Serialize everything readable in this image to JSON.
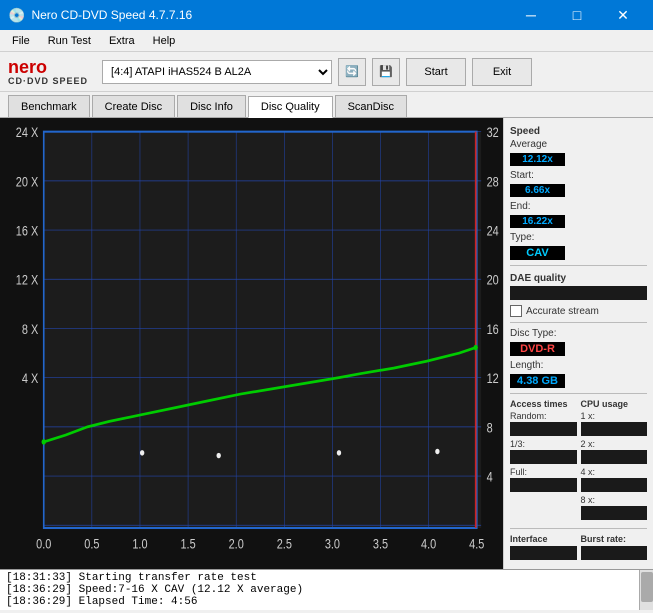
{
  "titleBar": {
    "title": "Nero CD-DVD Speed 4.7.7.16",
    "minimize": "─",
    "maximize": "□",
    "close": "✕"
  },
  "menuBar": {
    "items": [
      "File",
      "Run Test",
      "Extra",
      "Help"
    ]
  },
  "toolbar": {
    "logoNero": "nero",
    "logoDvd": "CD·DVD SPEED",
    "driveLabel": "[4:4]  ATAPI iHAS524  B AL2A",
    "startBtn": "Start",
    "exitBtn": "Exit"
  },
  "tabs": [
    {
      "label": "Benchmark",
      "active": false
    },
    {
      "label": "Create Disc",
      "active": false
    },
    {
      "label": "Disc Info",
      "active": false
    },
    {
      "label": "Disc Quality",
      "active": true
    },
    {
      "label": "ScanDisc",
      "active": false
    }
  ],
  "speedPanel": {
    "title": "Speed",
    "avgLabel": "Average",
    "avgValue": "12.12x",
    "startLabel": "Start:",
    "startValue": "6.66x",
    "endLabel": "End:",
    "endValue": "16.22x",
    "typeLabel": "Type:",
    "typeValue": "CAV"
  },
  "accessTimes": {
    "title": "Access times",
    "randomLabel": "Random:",
    "oneThirdLabel": "1/3:",
    "fullLabel": "Full:"
  },
  "cpuUsage": {
    "title": "CPU usage",
    "x1Label": "1 x:",
    "x2Label": "2 x:",
    "x4Label": "4 x:",
    "x8Label": "8 x:"
  },
  "daeQuality": {
    "label": "DAE quality"
  },
  "accurateStream": {
    "label": "Accurate stream"
  },
  "discInfo": {
    "typeLabel": "Disc Type:",
    "typeValue": "DVD-R",
    "lengthLabel": "Length:",
    "lengthValue": "4.38 GB"
  },
  "interface": {
    "title": "Interface",
    "burstLabel": "Burst rate:"
  },
  "chart": {
    "yAxisLeft": [
      "24 X",
      "20 X",
      "16 X",
      "12 X",
      "8 X",
      "4 X"
    ],
    "yAxisRight": [
      "32",
      "28",
      "24",
      "20",
      "16",
      "12",
      "8",
      "4"
    ],
    "xAxis": [
      "0.0",
      "0.5",
      "1.0",
      "1.5",
      "2.0",
      "2.5",
      "3.0",
      "3.5",
      "4.0",
      "4.5"
    ]
  },
  "log": {
    "lines": [
      "[18:31:33]  Starting transfer rate test",
      "[18:36:29]  Speed:7-16 X CAV (12.12 X average)",
      "[18:36:29]  Elapsed Time: 4:56"
    ]
  }
}
